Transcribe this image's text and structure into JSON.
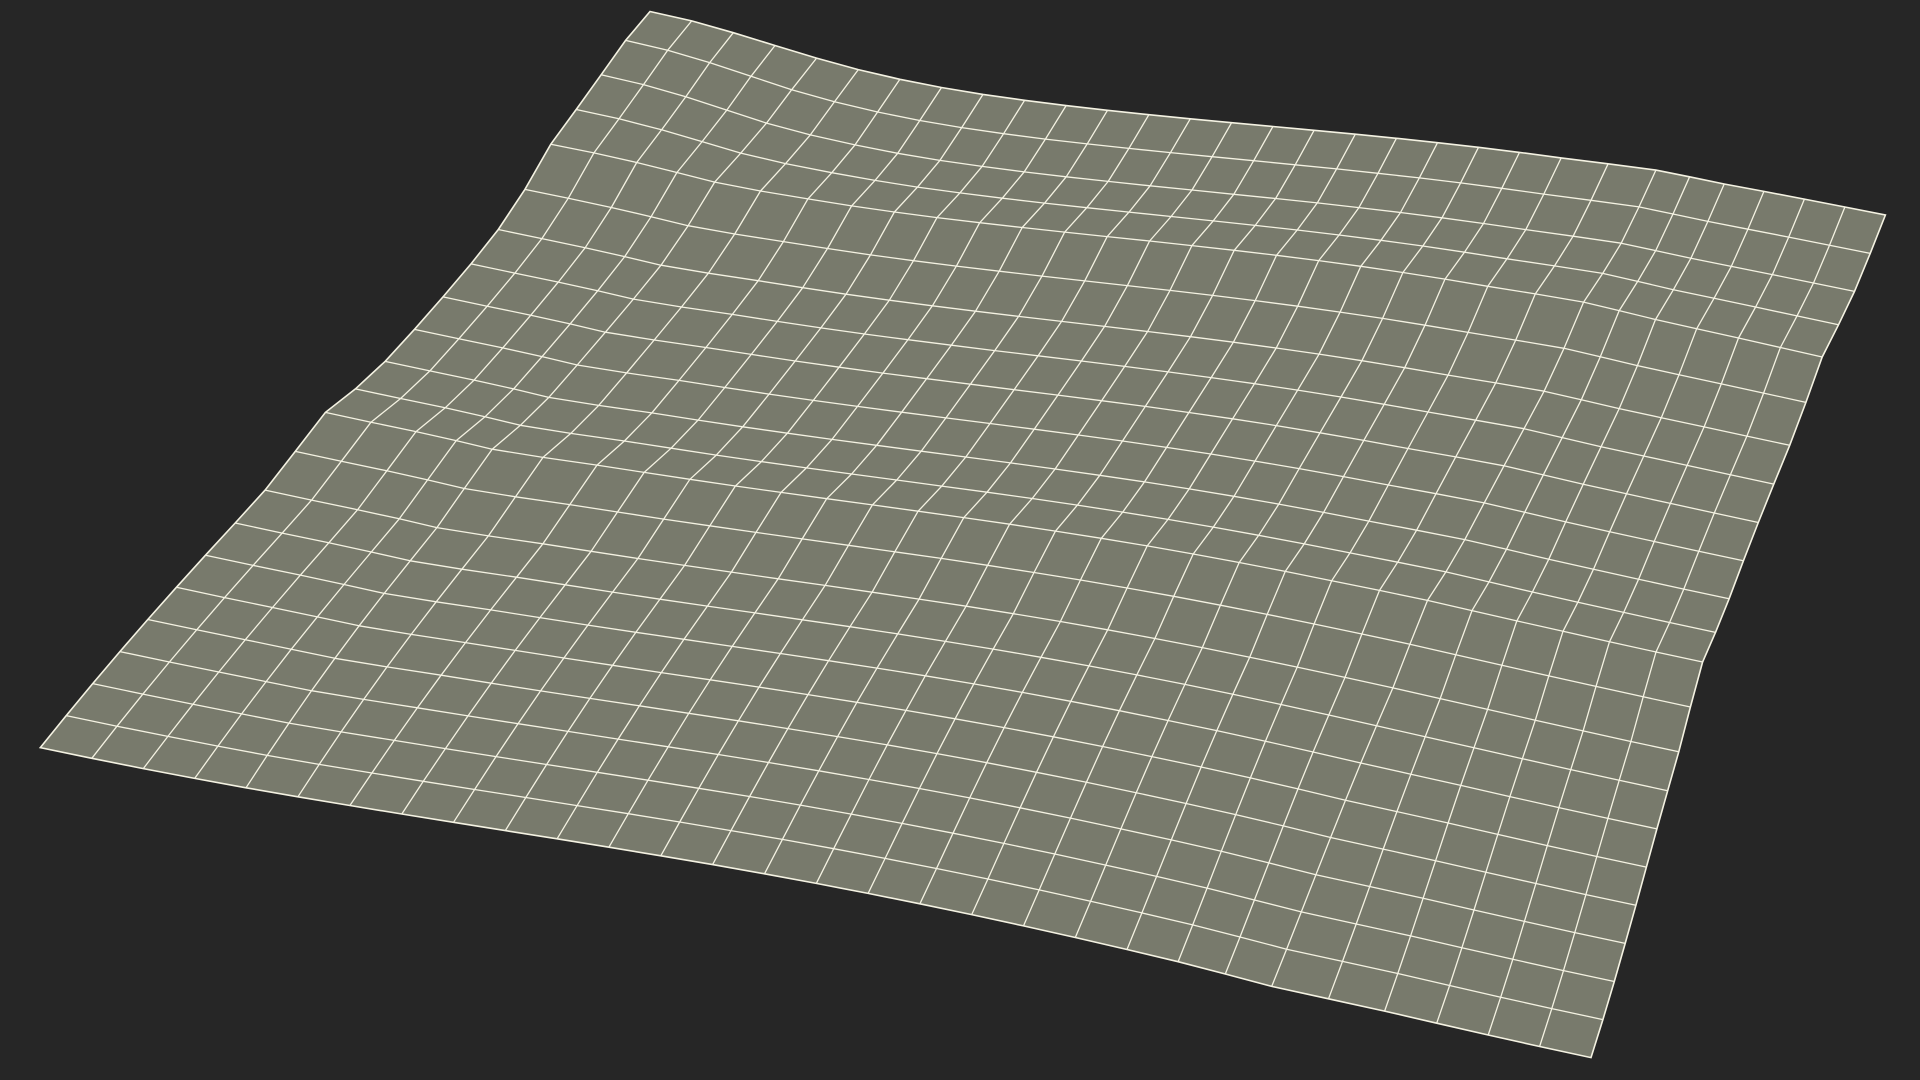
{
  "scene": {
    "background_color": "#262626",
    "object": "wireframe-cloth-mesh",
    "mesh_fill_color": "#787a6c",
    "wire_color": "#f4f2e2",
    "grid_rows": 22,
    "grid_cols": 30
  }
}
